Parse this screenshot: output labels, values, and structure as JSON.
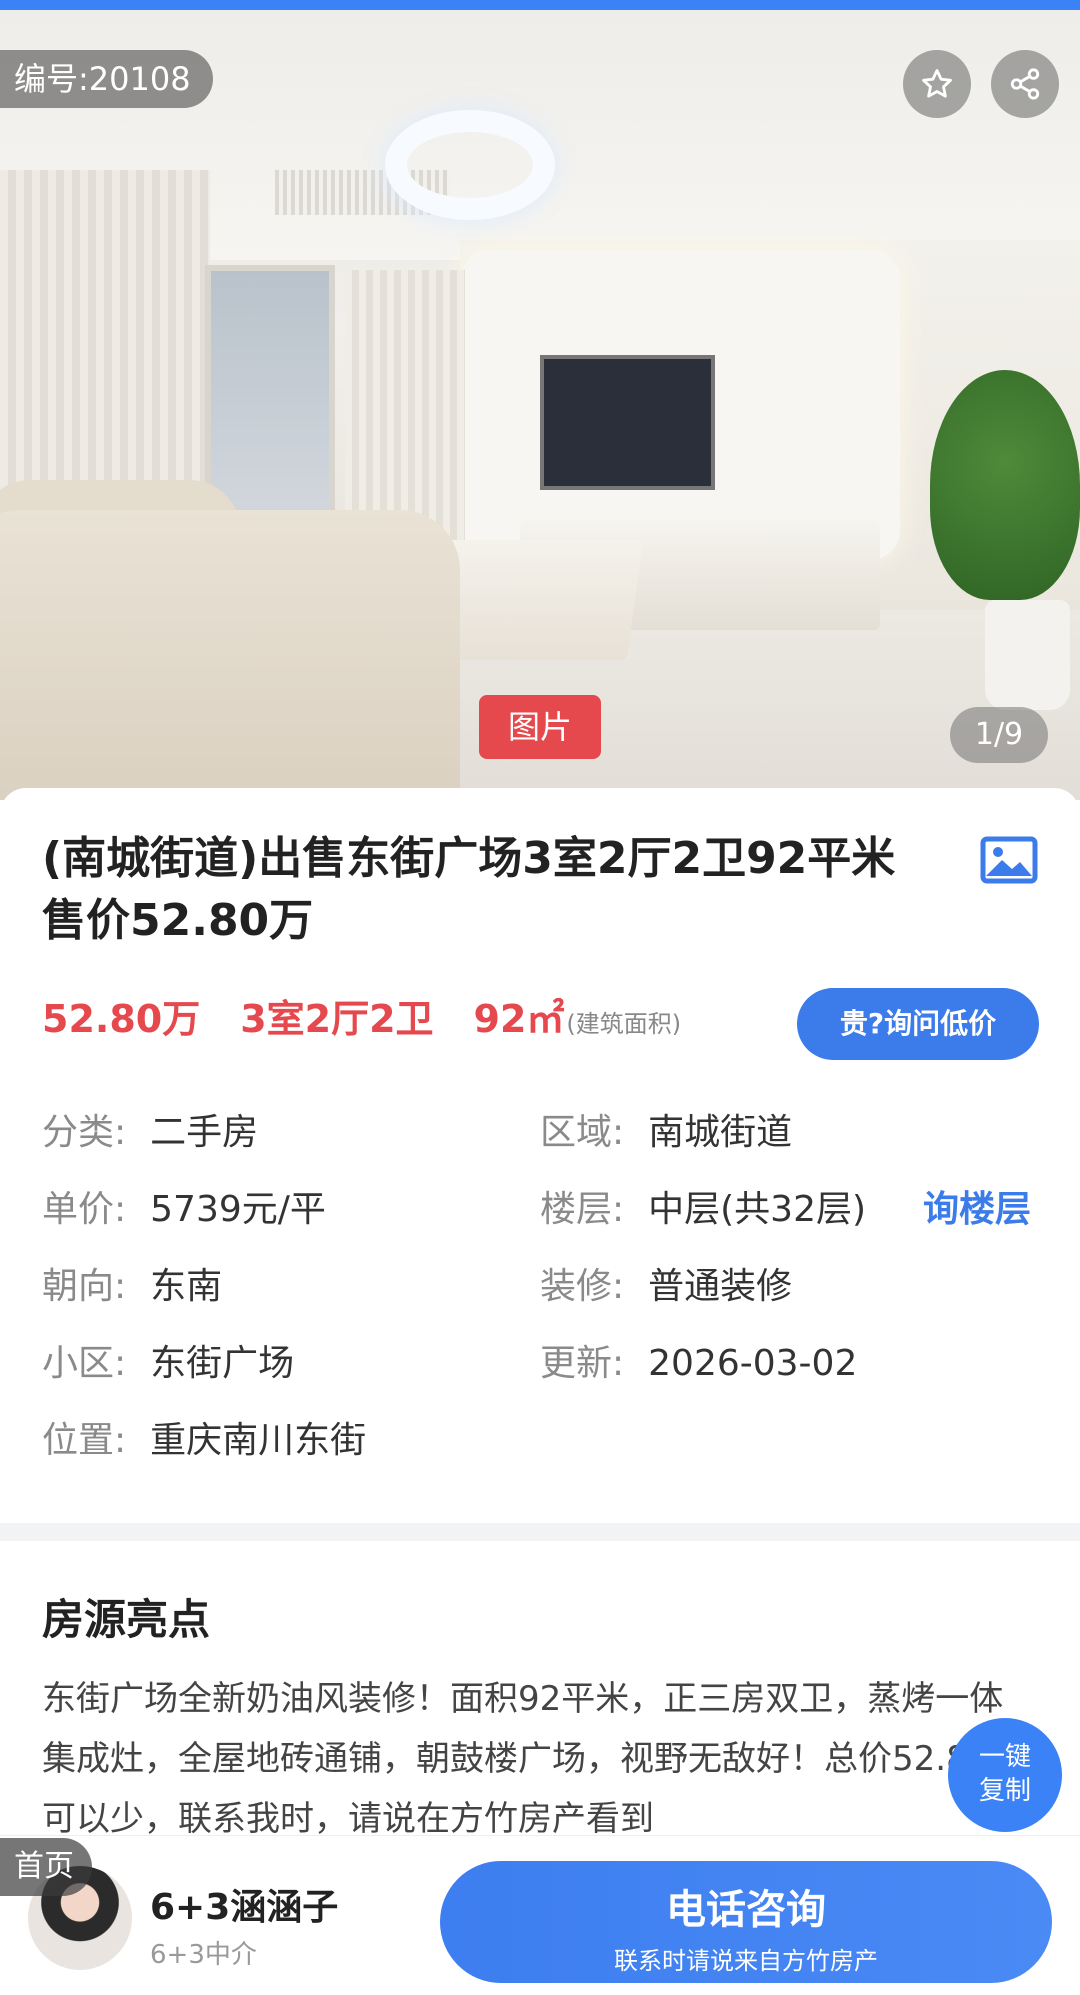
{
  "listing": {
    "id_label": "编号:20108",
    "image_tag": "图片",
    "image_counter": "1/9",
    "title": "(南城街道)出售东街广场3室2厅2卫92平米 售价52.80万",
    "price": "52.80万",
    "layout": "3室2厅2卫",
    "area": "92㎡",
    "area_note": "(建筑面积)",
    "ask_price_button": "贵?询问低价",
    "ask_floor_link": "询楼层"
  },
  "fields": {
    "category": {
      "k": "分类:",
      "v": "二手房"
    },
    "region": {
      "k": "区域:",
      "v": "南城街道"
    },
    "unit_price": {
      "k": "单价:",
      "v": "5739元/平"
    },
    "floor": {
      "k": "楼层:",
      "v": "中层(共32层)"
    },
    "orientation": {
      "k": "朝向:",
      "v": "东南"
    },
    "decoration": {
      "k": "装修:",
      "v": "普通装修"
    },
    "community": {
      "k": "小区:",
      "v": "东街广场"
    },
    "updated": {
      "k": "更新:",
      "v": "2026-03-02"
    },
    "location": {
      "k": "位置:",
      "v": "重庆南川东街"
    }
  },
  "highlights": {
    "title": "房源亮点",
    "text": "东街广场全新奶油风装修！面积92平米，正三房双卫，蒸烤一体集成灶，全屋地砖通铺，朝鼓楼广场，视野无敌好！总价52.8万可以少，联系我时，请说在方竹房产看到"
  },
  "copy_button": {
    "line1": "一键",
    "line2": "复制"
  },
  "agent": {
    "home_tag": "首页",
    "name": "6+3涵涵子",
    "company": "6+3中介",
    "call_label": "电话咨询",
    "call_sub": "联系时请说来自方竹房产"
  },
  "icons": [
    "star-icon",
    "share-icon",
    "image-gallery-icon"
  ],
  "colors": {
    "accent": "#3b7bea",
    "price": "#e5484d",
    "tag": "#e5484d"
  }
}
